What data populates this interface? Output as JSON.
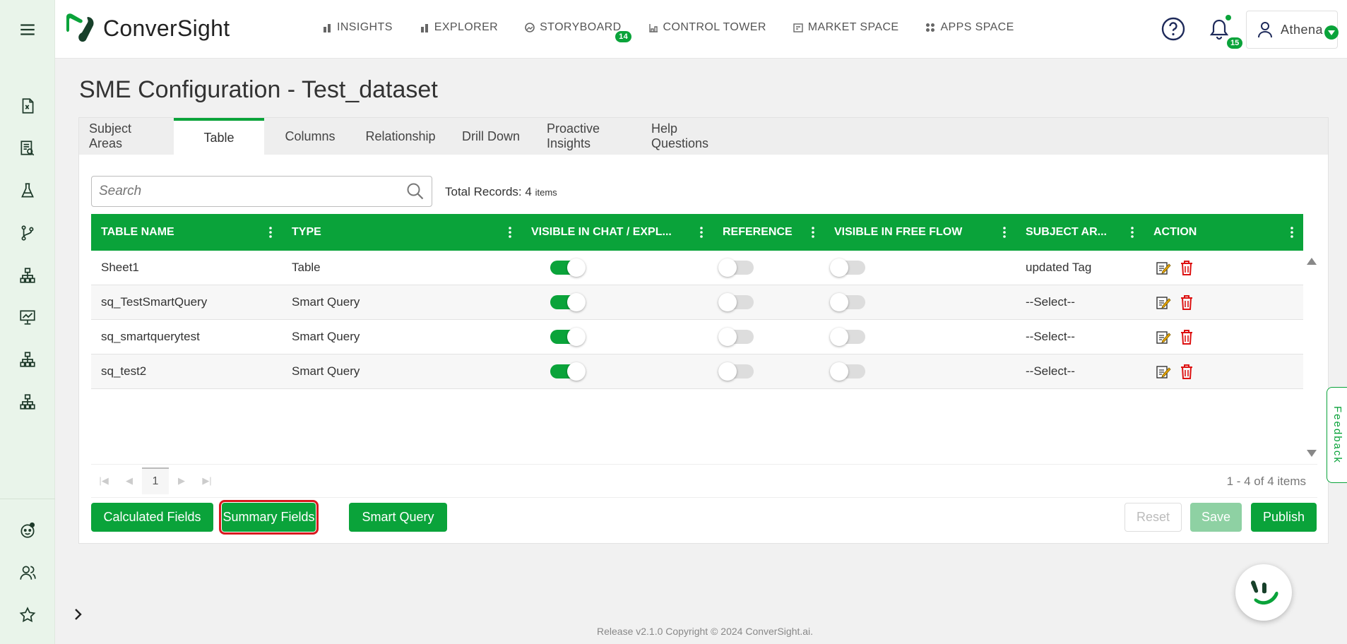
{
  "nav": {
    "insights": "INSIGHTS",
    "explorer": "EXPLORER",
    "storyboard": "STORYBOARD",
    "storyboard_badge": "14",
    "control_tower": "CONTROL TOWER",
    "market_space": "MARKET SPACE",
    "apps_space": "APPS SPACE"
  },
  "brand": {
    "name": "ConverSight",
    "accent": "#0aa33a"
  },
  "header": {
    "notifications_count": "15",
    "user_name": "Athena"
  },
  "page": {
    "title": "SME Configuration - Test_dataset"
  },
  "tabs": [
    "Subject Areas",
    "Table",
    "Columns",
    "Relationship",
    "Drill Down",
    "Proactive Insights",
    "Help Questions"
  ],
  "active_tab": "Table",
  "search": {
    "placeholder": "Search"
  },
  "total": {
    "label": "Total Records:",
    "count": "4",
    "unit": "items"
  },
  "table": {
    "columns": [
      "TABLE NAME",
      "TYPE",
      "VISIBLE IN CHAT / EXPL...",
      "REFERENCE",
      "VISIBLE IN FREE FLOW",
      "SUBJECT AR...",
      "ACTION"
    ],
    "rows": [
      {
        "name": "Sheet1",
        "type": "Table",
        "visible_chat": true,
        "reference": false,
        "free_flow": false,
        "subject_area": "updated Tag"
      },
      {
        "name": "sq_TestSmartQuery",
        "type": "Smart Query",
        "visible_chat": true,
        "reference": false,
        "free_flow": false,
        "subject_area": "--Select--"
      },
      {
        "name": "sq_smartquerytest",
        "type": "Smart Query",
        "visible_chat": true,
        "reference": false,
        "free_flow": false,
        "subject_area": "--Select--"
      },
      {
        "name": "sq_test2",
        "type": "Smart Query",
        "visible_chat": true,
        "reference": false,
        "free_flow": false,
        "subject_area": "--Select--"
      }
    ]
  },
  "pager": {
    "page": "1",
    "info": "1 - 4 of 4 items"
  },
  "buttons": {
    "calculated_fields": "Calculated Fields",
    "summary_fields": "Summary Fields",
    "smart_query": "Smart Query",
    "reset": "Reset",
    "save": "Save",
    "publish": "Publish"
  },
  "footer": {
    "text": "Release v2.1.0 Copyright © 2024 ConverSight.ai."
  },
  "feedback": {
    "label": "Feedback"
  },
  "sidebar_icons": [
    "menu-icon",
    "excel-file-icon",
    "report-search-icon",
    "flask-icon",
    "git-branch-icon",
    "hierarchy-icon",
    "presentation-chart-icon",
    "hierarchy-icon",
    "hierarchy-icon",
    "bot-face-icon",
    "users-icon",
    "star-icon",
    "chevron-right-icon"
  ]
}
